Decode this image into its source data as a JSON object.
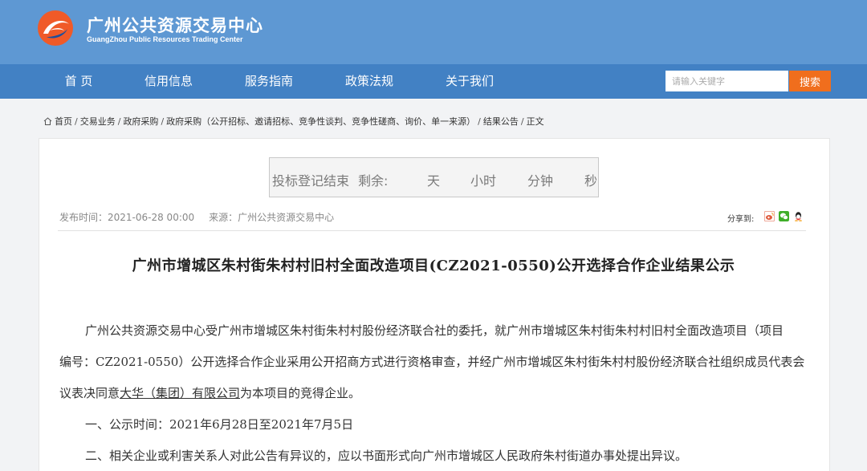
{
  "site": {
    "title": "广州公共资源交易中心",
    "subtitle": "GuangZhou Public Resources Trading Center",
    "brand_color": "#5e98d3",
    "nav_color": "#4281c4"
  },
  "nav": {
    "items": [
      "首 页",
      "信用信息",
      "服务指南",
      "政策法规",
      "关于我们"
    ]
  },
  "search": {
    "placeholder": "请输入关键字",
    "button_label": "搜索",
    "button_color": "#f06e1d"
  },
  "breadcrumb": {
    "home_icon": "home-icon",
    "items": [
      "首页",
      "交易业务",
      "政府采购",
      "政府采购（公开招标、邀请招标、竞争性谈判、竞争性磋商、询价、单一来源）",
      "结果公告",
      "正文"
    ],
    "separator": "/"
  },
  "countdown": {
    "label": "投标登记结束",
    "remaining": "剩余:",
    "day": "天",
    "hour": "小时",
    "minute": "分钟",
    "second": "秒"
  },
  "meta": {
    "published": "发布时间：2021-06-28 00:00",
    "source": "来源：广州公共资源交易中心"
  },
  "share": {
    "label": "分享到:",
    "icons": [
      "weibo-icon",
      "wechat-icon",
      "qq-icon"
    ]
  },
  "article": {
    "title": "广州市增城区朱村街朱村村旧村全面改造项目(CZ2021-0550)公开选择合作企业结果公示",
    "para1_line1": "广州公共资源交易中心受广州市增城区朱村街朱村村股份经济联合社的委托，就广州市增城区朱村街朱村村旧村全面改造项目（项目",
    "para1_line2": "编号：CZ2021-0550）公开选择合作企业采用公开招商方式进行资格审查，并经广州市增城区朱村街朱村村股份经济联合社组织成员代表会",
    "para1_line3_a": "议表决同意",
    "para1_line3_company": "大华（集团）有限公司",
    "para1_line3_b": "为本项目的竞得企业。",
    "item1": "一、公示时间：2021年6月28日至2021年7月5日",
    "item2": "二、相关企业或利害关系人对此公告有异议的，应以书面形式向广州市增城区人民政府朱村街道办事处提出异议。"
  }
}
